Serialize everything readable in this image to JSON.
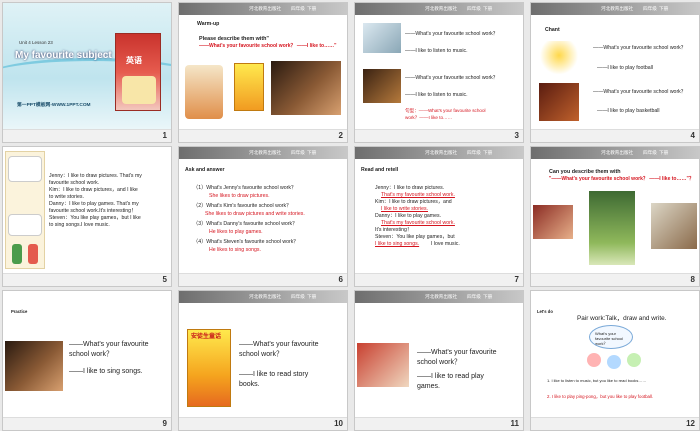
{
  "header": {
    "publisher": "河北教育出版社",
    "grade": "四年级",
    "term": "下册"
  },
  "slides": [
    {
      "num": "1",
      "unit": "Unit 4  Lesson 23",
      "title": "My favourite subject",
      "book_cover": "英语",
      "footer": "第一PPT模板网-WWW.1PPT.COM"
    },
    {
      "num": "2",
      "label": "Warm-up",
      "q_black": "Please describe them with\"",
      "q_red": "——What's your favourite school work？ ——I like to……\""
    },
    {
      "num": "3",
      "l1": "——What's your favourite school work？",
      "l2": "——I like to listen to music.",
      "l3": "——What's your favourite school work？",
      "l4": "——I like to listen to music.",
      "p1": "句型：——What's your favourite school",
      "p2": "work？——I like to……"
    },
    {
      "num": "4",
      "label": "Chant",
      "l1": "——What's your favourite school work？",
      "l2": "——I like to play football",
      "l3": "——What's your favourite school work？",
      "l4": "——I like to play basketball"
    },
    {
      "num": "5",
      "text": [
        "Jenny：I like to draw pictures. That's my",
        "favourite school work.",
        "Kim：I like to draw pictures，and I like",
        "to write stories.",
        "Danny：I like to play games. That's my",
        "favourite school work.It's interesting！",
        "Steven：You like play games，but I like",
        "to sing songs.I love music."
      ]
    },
    {
      "num": "6",
      "label": "Ask and answer",
      "q1": "（1）What's Jenny's favourite school work？",
      "a1": "She likes to draw pictures.",
      "q2": "（2）What's Kim's favourite school work？",
      "a2": "She likes to draw pictures and write stories.",
      "q3": "（3）What's Danny's favourite school work？",
      "a3": "He likes to play games.",
      "q4": "（4）What's Steven's favourite school work？",
      "a4": "He likes to sing songs."
    },
    {
      "num": "7",
      "label": "Read and retell",
      "r1": "Jenny：I like to draw pictures.",
      "r2": "That's my favourite school work.",
      "r3": "Kim：I like to draw pictures，and",
      "r4": "I like to write stories.",
      "r5": "Danny：I like to play games.",
      "r6": "That's my favourite school work.",
      "r7": "It's interesting！",
      "r8": "Steven：You like play games，but",
      "r9": "I like to sing songs.",
      "r10": "I love music."
    },
    {
      "num": "8",
      "q_black": "Can you describe them with",
      "q_red": "\"——What's your favourite school work？ ——I like to……\"？"
    },
    {
      "num": "9",
      "label": "Practice",
      "l1": "——What's your favourite",
      "l2": "school work？",
      "l3": "——I like to sing songs."
    },
    {
      "num": "10",
      "book": "安徒生童话",
      "l1": "——What's your favourite",
      "l2": "school work？",
      "l3": "——I like to read story",
      "l4": "books."
    },
    {
      "num": "11",
      "l1": "——What's your favourite",
      "l2": "school work？",
      "l3": "——I like to read play",
      "l4": "games."
    },
    {
      "num": "12",
      "label": "Let's do",
      "title": "Pair work:Talk，draw and write.",
      "bubble": "What's your favourite school work？",
      "w1": "1. I like to listen to music, but you like to read books……",
      "w2": "2. I like to play ping-pong，but you like to play football."
    }
  ]
}
